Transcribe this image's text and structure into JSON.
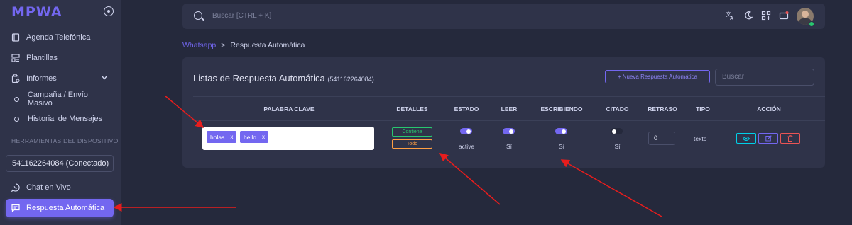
{
  "app": {
    "logo": "MPWA"
  },
  "sidebar": {
    "items": [
      {
        "label": "Agenda Telefónica",
        "icon": "book-icon"
      },
      {
        "label": "Plantillas",
        "icon": "template-icon"
      },
      {
        "label": "Informes",
        "icon": "report-icon"
      },
      {
        "label": "Campaña / Envío Masivo"
      },
      {
        "label": "Historial de Mensajes"
      }
    ],
    "section_header": "HERRAMIENTAS DEL DISPOSITIVO",
    "device": "541162264084 (Conectado)",
    "chat": {
      "label": "Chat en Vivo",
      "icon": "whatsapp-icon"
    },
    "active": {
      "label": "Respuesta Automática",
      "icon": "message-icon"
    }
  },
  "topbar": {
    "search_placeholder": "Buscar [CTRL + K]"
  },
  "breadcrumb": {
    "parent": "Whatsapp",
    "separator": ">",
    "current": "Respuesta Automática"
  },
  "card": {
    "title": "Listas de Respuesta Automática",
    "subtitle": "(541162264084)",
    "new_button": "+ Nueva Respuesta Automática",
    "search_placeholder": "Buscar"
  },
  "table": {
    "headers": [
      "PALABRA CLAVE",
      "DETALLES",
      "ESTADO",
      "LEER",
      "ESCRIBIENDO",
      "CITADO",
      "RETRASO",
      "TIPO",
      "ACCIÓN"
    ],
    "row": {
      "keywords": [
        {
          "label": "holas",
          "remove": "x"
        },
        {
          "label": "hello",
          "remove": "x"
        }
      ],
      "details": [
        "Contiene",
        "Todo"
      ],
      "estado": {
        "on": true,
        "text": "active"
      },
      "leer": {
        "on": true,
        "text": "Sí"
      },
      "escribiendo": {
        "on": true,
        "text": "Sí"
      },
      "citado": {
        "on": false,
        "text": "Sí"
      },
      "retraso": "0",
      "tipo": "texto",
      "actions": [
        "eye-icon",
        "edit-icon",
        "trash-icon"
      ]
    }
  },
  "colors": {
    "accent": "#7367f0",
    "success": "#28c76f",
    "warning": "#ff9f43",
    "danger": "#ea5455",
    "info": "#00cfe8",
    "annotation": "#e81d1d"
  }
}
